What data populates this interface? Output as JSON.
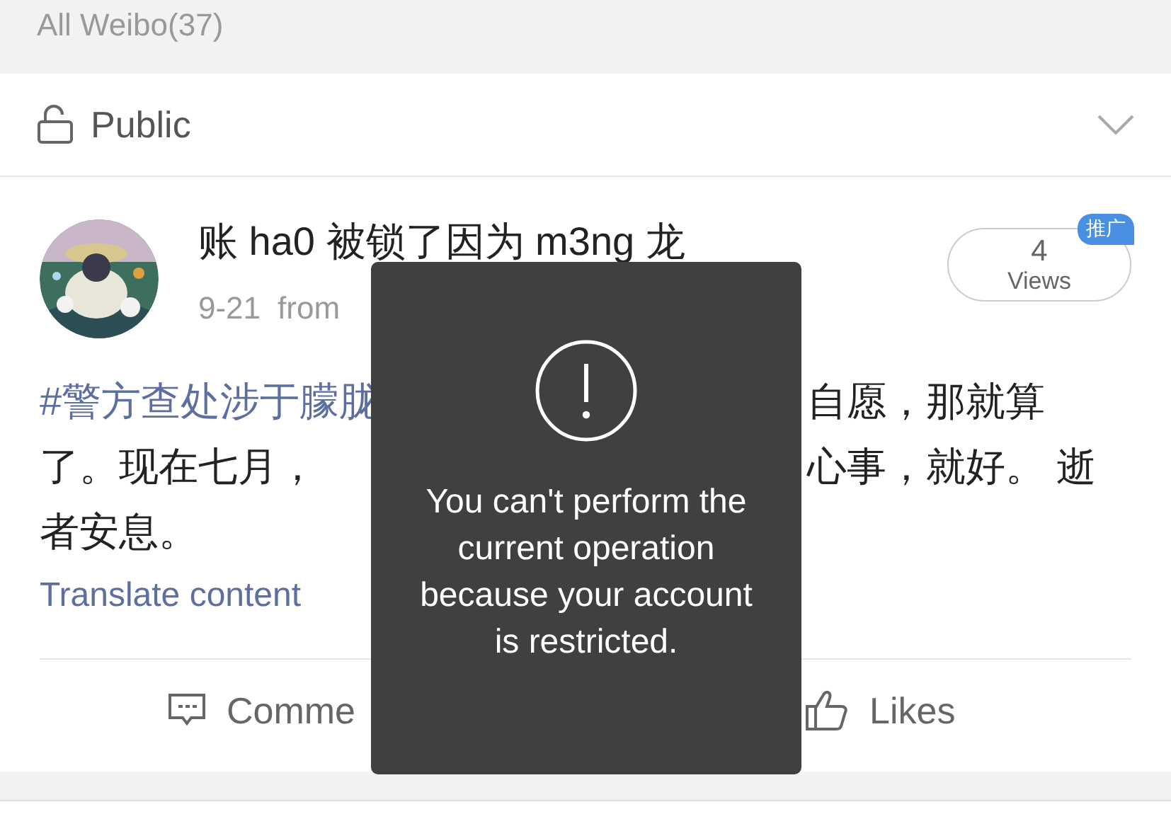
{
  "header": {
    "title": "All Weibo(37)"
  },
  "visibility": {
    "label": "Public"
  },
  "post": {
    "author": "账 ha0 被锁了因为 m3ng 龙",
    "date": "9-21",
    "source": "from",
    "views": {
      "count": "4",
      "label": "Views",
      "badge": "推广"
    },
    "content": [
      {
        "left": [
          {
            "kind": "hashtag",
            "text": "#警方查处涉于朦胧"
          }
        ],
        "right": [
          {
            "kind": "text",
            "text": "自愿，那就算"
          }
        ]
      },
      {
        "left": [
          {
            "kind": "text",
            "text": "了。现在七月，"
          }
        ],
        "right": [
          {
            "kind": "text",
            "text": "心事，就好。 逝"
          }
        ]
      },
      {
        "left": [
          {
            "kind": "text",
            "text": "者安息。"
          }
        ]
      }
    ],
    "translate": "Translate content",
    "actions": [
      {
        "kind": "comment",
        "label": "Comme"
      },
      {
        "kind": "like",
        "label": "Likes"
      }
    ]
  },
  "toast": {
    "message": "You can't perform the current operation because your account is restricted."
  }
}
